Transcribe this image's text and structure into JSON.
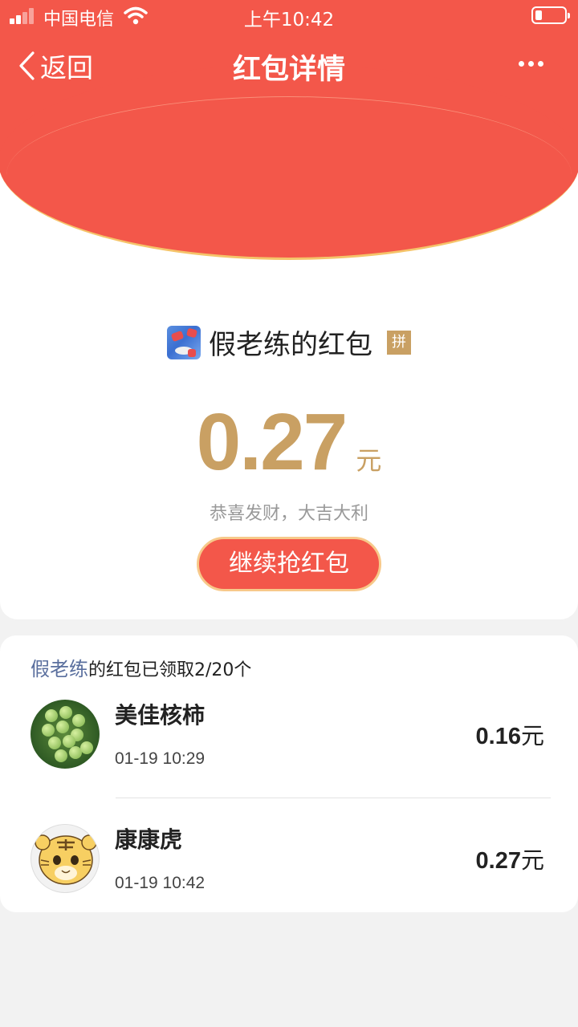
{
  "status_bar": {
    "carrier": "中国电信",
    "time": "上午10:42"
  },
  "nav": {
    "back_label": "返回",
    "title": "红包详情"
  },
  "packet": {
    "sender_name": "假老练的红包",
    "badge": "拼",
    "amount": "0.27",
    "unit": "元",
    "blessing": "恭喜发财，大吉大利",
    "action_label": "继续抢红包"
  },
  "summary": {
    "sender": "假老练",
    "text": "的红包已领取2/20个"
  },
  "receivers": [
    {
      "name": "美佳核柿",
      "time": "01-19 10:29",
      "amount": "0.16",
      "unit": "元",
      "avatar": "green-fruit-photo"
    },
    {
      "name": "康康虎",
      "time": "01-19 10:42",
      "amount": "0.27",
      "unit": "元",
      "avatar": "cartoon-tiger"
    }
  ],
  "colors": {
    "red": "#f3574a",
    "gold": "#c9a063",
    "link_blue": "#5a6f9e"
  }
}
